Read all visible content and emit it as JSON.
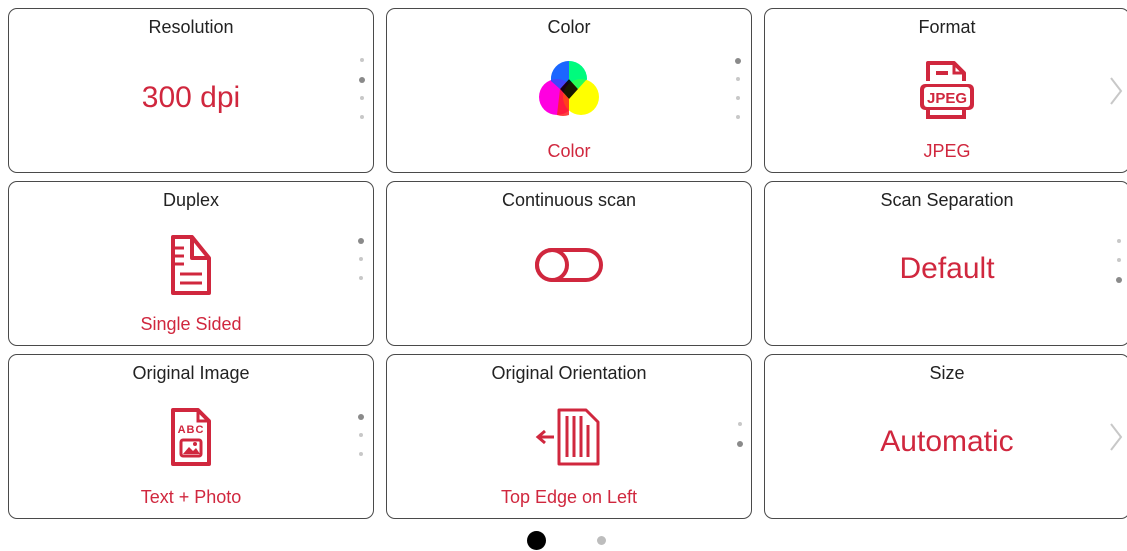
{
  "colors": {
    "accent": "#d0273e",
    "border": "#4a4a4a",
    "dot_inactive": "#c8c8c8",
    "dot_active": "#8a8a8a"
  },
  "cards": {
    "resolution": {
      "title": "Resolution",
      "value": "300 dpi"
    },
    "color": {
      "title": "Color",
      "value": "Color",
      "icon": "color-wheel-icon"
    },
    "format": {
      "title": "Format",
      "value": "JPEG",
      "icon_text": "JPEG",
      "icon": "jpeg-file-icon"
    },
    "duplex": {
      "title": "Duplex",
      "value": "Single Sided",
      "icon": "single-sided-page-icon"
    },
    "continuous": {
      "title": "Continuous scan",
      "icon": "toggle-off-icon"
    },
    "separation": {
      "title": "Scan Separation",
      "value": "Default"
    },
    "original_image": {
      "title": "Original Image",
      "value": "Text + Photo",
      "icon_text": "ABC",
      "icon": "text-photo-doc-icon"
    },
    "orientation": {
      "title": "Original Orientation",
      "value": "Top Edge on Left",
      "icon": "top-edge-left-icon"
    },
    "size": {
      "title": "Size",
      "value": "Automatic"
    }
  },
  "pager": {
    "pages": 2,
    "current": 1
  }
}
